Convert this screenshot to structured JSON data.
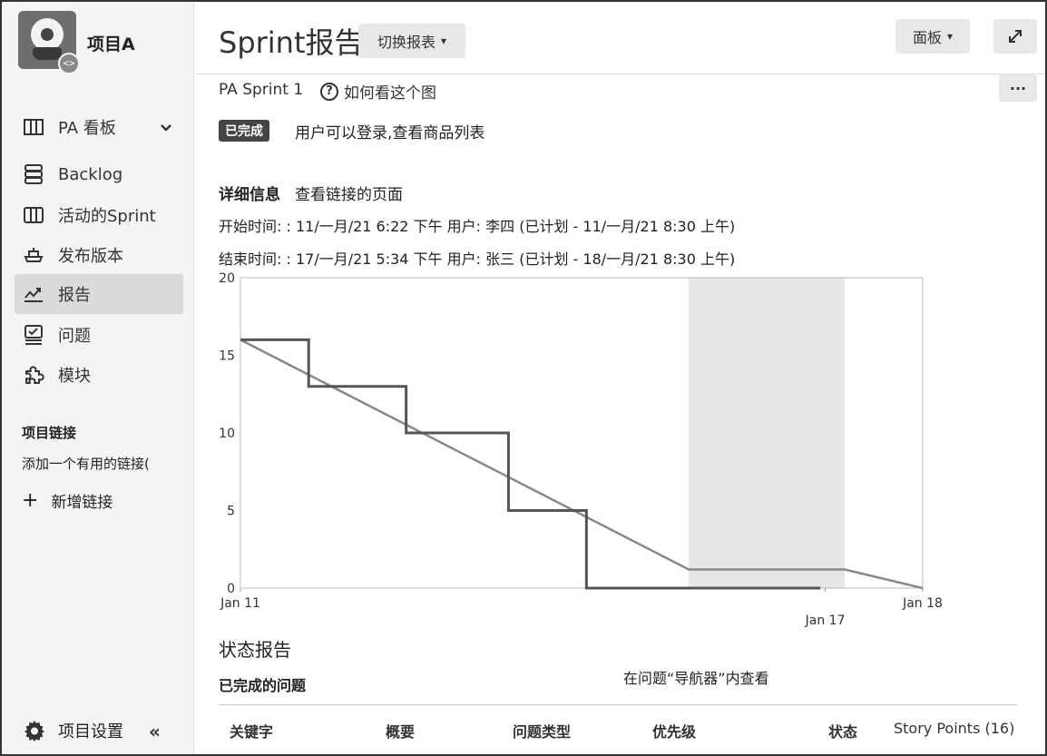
{
  "project": {
    "name": "项目A",
    "avatar_badge": "<>"
  },
  "sidebar": {
    "items": [
      {
        "label": "PA 看板",
        "icon": "board-icon",
        "has_chevron": true
      },
      {
        "label": "Backlog",
        "icon": "backlog-icon"
      },
      {
        "label": "活动的Sprint",
        "icon": "sprint-icon"
      },
      {
        "label": "发布版本",
        "icon": "release-icon"
      },
      {
        "label": "报告",
        "icon": "reports-icon",
        "active": true
      },
      {
        "label": "问题",
        "icon": "issues-icon"
      },
      {
        "label": "模块",
        "icon": "components-icon"
      }
    ],
    "links_title": "项目链接",
    "links_desc": "添加一个有用的链接(",
    "add_link": "新增链接",
    "settings": "项目设置",
    "collapse": "«"
  },
  "header": {
    "title": "Sprint报告",
    "switch_report": "切换报表",
    "board_button": "面板",
    "more_button": "···"
  },
  "sprint": {
    "name": "PA Sprint 1",
    "help": "如何看这个图",
    "status_badge": "已完成",
    "goal": "用户可以登录,查看商品列表"
  },
  "details": {
    "title": "详细信息",
    "link": "查看链接的页面",
    "start_line": "开始时间: :  11/一月/21 6:22 下午  用户:  李四  (已计划 - 11/一月/21 8:30 上午)",
    "end_line": "结束时间: :  17/一月/21 5:34 下午  用户:  张三  (已计划 - 18/一月/21 8:30 上午)"
  },
  "chart_data": {
    "type": "line",
    "title": "",
    "xlabel": "",
    "ylabel": "",
    "ylim": [
      0,
      20
    ],
    "y_ticks": [
      0,
      5,
      10,
      15,
      20
    ],
    "x_range_days": [
      0,
      7
    ],
    "x_ticks": [
      {
        "day": 0,
        "label": "Jan 11",
        "row": 1
      },
      {
        "day": 6.0,
        "label": "Jan 17",
        "row": 2
      },
      {
        "day": 7,
        "label": "Jan 18",
        "row": 1
      }
    ],
    "shaded_region_days": [
      4.6,
      6.2
    ],
    "series": [
      {
        "kind": "guideline",
        "color": "#888888",
        "points": [
          [
            0,
            16
          ],
          [
            4.6,
            1.2
          ],
          [
            6.2,
            1.2
          ],
          [
            7,
            0
          ]
        ]
      },
      {
        "kind": "remaining",
        "color": "#555555",
        "step_points": [
          [
            0,
            16
          ],
          [
            0.7,
            16
          ],
          [
            0.7,
            13
          ],
          [
            1.7,
            13
          ],
          [
            1.7,
            10
          ],
          [
            2.75,
            10
          ],
          [
            2.75,
            5
          ],
          [
            3.55,
            5
          ],
          [
            3.55,
            0
          ],
          [
            5.95,
            0
          ]
        ]
      }
    ]
  },
  "status_report": {
    "title": "状态报告",
    "completed_title": "已完成的问题",
    "navigator_link": "在问题“导航器”内查看",
    "columns": [
      "关键字",
      "概要",
      "问题类型",
      "优先级",
      "状态",
      "Story Points (16)"
    ]
  }
}
